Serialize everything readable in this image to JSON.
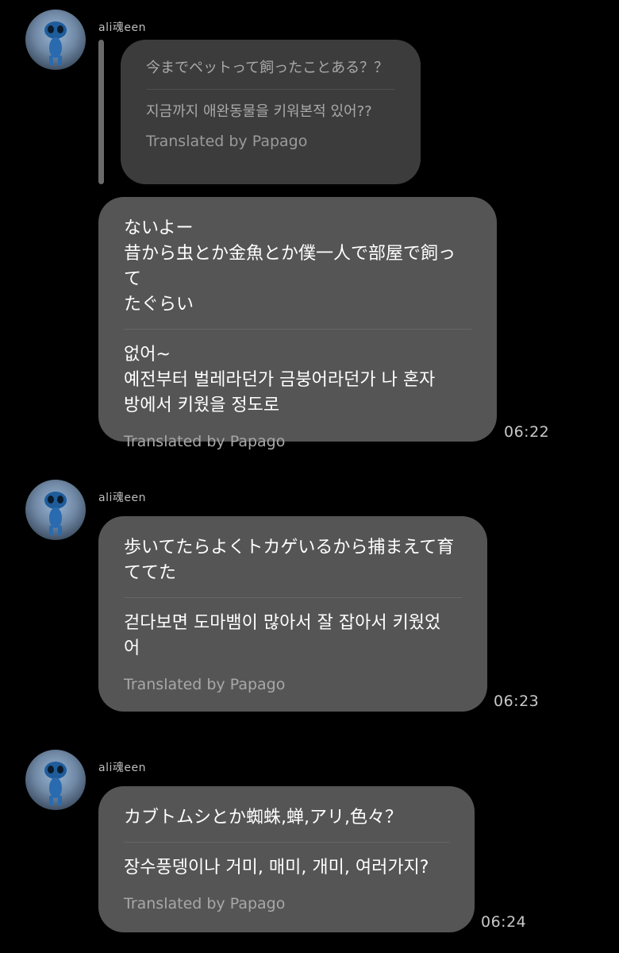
{
  "messages": [
    {
      "username": "ali魂een",
      "quoted": {
        "original": "今までペットって飼ったことある？？",
        "translation": "지금까지 애완동물을 키워본적 있어??",
        "translated_label": "Translated by Papago"
      },
      "original": "ないよー\n昔から虫とか金魚とか僕一人で部屋で飼って\nたぐらい",
      "translation": "없어~\n예전부터 벌레라던가 금붕어라던가 나 혼자\n방에서 키웠을 정도로",
      "translated_label": "Translated by Papago",
      "time": "06:22"
    },
    {
      "username": "ali魂een",
      "original": "歩いてたらよくトカゲいるから捕まえて育\nててた",
      "translation": "걷다보면 도마뱀이 많아서 잘 잡아서 키웠었\n어",
      "translated_label": "Translated by Papago",
      "time": "06:23"
    },
    {
      "username": "ali魂een",
      "original": "カブトムシとか蜘蛛,蝉,アリ,色々？",
      "translation": "장수풍뎅이나 거미, 매미, 개미, 여러가지?",
      "translated_label": "Translated by Papago",
      "time": "06:24"
    }
  ]
}
